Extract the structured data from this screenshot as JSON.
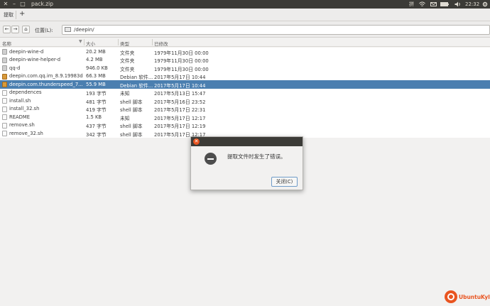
{
  "topbar": {
    "close_glyph": "✕",
    "minimize_glyph": "–",
    "maximize_glyph": "□",
    "window_title": "pack.zip",
    "tray": {
      "time": "22:32",
      "input_method": "拼",
      "network_icon": "wifi-icon",
      "mail_icon": "mail-icon",
      "battery_icon": "battery-icon",
      "volume_icon": "volume-icon",
      "power_icon": "gear-icon"
    }
  },
  "toolbar": {
    "extract_label": "提取",
    "add_label": "+"
  },
  "location": {
    "back": "←",
    "forward": "→",
    "home": "⌂",
    "label": "位置(L):",
    "path": "/deepin/"
  },
  "columns": {
    "name": "名称",
    "size": "大小",
    "type": "类型",
    "modified": "已修改"
  },
  "files": [
    {
      "name": "deepin-wine-d",
      "size": "20.2 MB",
      "type": "文件夹",
      "modified": "1979年11月30日 00:00",
      "icon": "folder"
    },
    {
      "name": "deepin-wine-helper-d",
      "size": "4.2 MB",
      "type": "文件夹",
      "modified": "1979年11月30日 00:00",
      "icon": "folder"
    },
    {
      "name": "qq-d",
      "size": "946.0 KB",
      "type": "文件夹",
      "modified": "1979年11月30日 00:00",
      "icon": "folder"
    },
    {
      "name": "deepin.com.qq.im_8.9.19983d...",
      "size": "66.3 MB",
      "type": "Debian 软件...",
      "modified": "2017年5月17日 10:44",
      "icon": "deb"
    },
    {
      "name": "deepin.com.thunderspeed_7....",
      "size": "55.9 MB",
      "type": "Debian 软件...",
      "modified": "2017年5月17日 10:44",
      "icon": "deb",
      "selected": true
    },
    {
      "name": "dependences",
      "size": "193 字节",
      "type": "未知",
      "modified": "2017年5月13日 15:47",
      "icon": "file"
    },
    {
      "name": "install.sh",
      "size": "481 字节",
      "type": "shell 脚本",
      "modified": "2017年5月16日 23:52",
      "icon": "file"
    },
    {
      "name": "install_32.sh",
      "size": "419 字节",
      "type": "shell 脚本",
      "modified": "2017年5月17日 22:31",
      "icon": "file"
    },
    {
      "name": "README",
      "size": "1.5 KB",
      "type": "未知",
      "modified": "2017年5月17日 12:17",
      "icon": "file"
    },
    {
      "name": "remove.sh",
      "size": "437 字节",
      "type": "shell 脚本",
      "modified": "2017年5月17日 12:19",
      "icon": "file"
    },
    {
      "name": "remove_32.sh",
      "size": "342 字节",
      "type": "shell 脚本",
      "modified": "2017年5月17日 12:17",
      "icon": "file"
    }
  ],
  "dialog": {
    "close_glyph": "✕",
    "message": "提取文件时发生了错误。",
    "button_label": "关闭(C)",
    "icon": "error-icon"
  },
  "branding": {
    "logo_text": "UbuntuKylin",
    "accent": "#e95420",
    "selection_color": "#4b7fb0"
  }
}
